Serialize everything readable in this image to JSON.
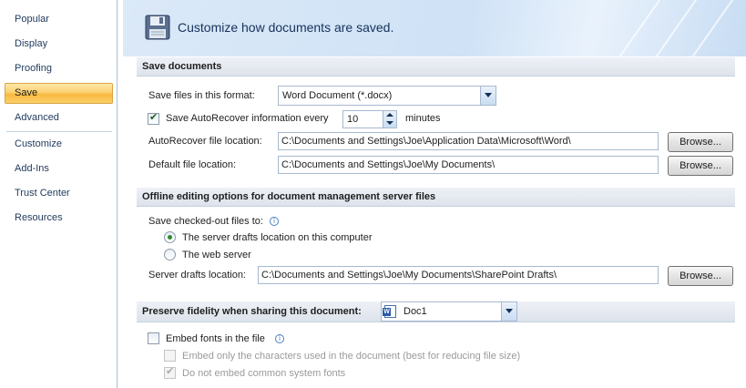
{
  "sidebar": {
    "items": [
      {
        "label": "Popular"
      },
      {
        "label": "Display"
      },
      {
        "label": "Proofing"
      },
      {
        "label": "Save"
      },
      {
        "label": "Advanced"
      },
      {
        "label": "Customize"
      },
      {
        "label": "Add-Ins"
      },
      {
        "label": "Trust Center"
      },
      {
        "label": "Resources"
      }
    ],
    "selected": "Save"
  },
  "banner": {
    "title": "Customize how documents are saved.",
    "icon": "floppy-disk-icon"
  },
  "save_documents": {
    "header": "Save documents",
    "format_label": "Save files in this format:",
    "format_value": "Word Document (*.docx)",
    "autorecover_checkbox_label": "Save AutoRecover information every",
    "autorecover_checked": true,
    "autorecover_minutes": "10",
    "minutes_label": "minutes",
    "autorecover_location_label": "AutoRecover file location:",
    "autorecover_location_value": "C:\\Documents and Settings\\Joe\\Application Data\\Microsoft\\Word\\",
    "default_location_label": "Default file location:",
    "default_location_value": "C:\\Documents and Settings\\Joe\\My Documents\\",
    "browse_label": "Browse..."
  },
  "offline_editing": {
    "header": "Offline editing options for document management server files",
    "checked_out_label": "Save checked-out files to:",
    "radio_server_drafts": "The server drafts location on this computer",
    "radio_web_server": "The web server",
    "selected_radio": "server_drafts",
    "drafts_location_label": "Server drafts location:",
    "drafts_location_value": "C:\\Documents and Settings\\Joe\\My Documents\\SharePoint Drafts\\",
    "browse_label": "Browse..."
  },
  "fidelity": {
    "header": "Preserve fidelity when sharing this document:",
    "document_value": "Doc1",
    "embed_fonts_label": "Embed fonts in the file",
    "embed_fonts_checked": false,
    "embed_used_chars_label": "Embed only the characters used in the document (best for reducing file size)",
    "embed_used_chars_checked": false,
    "no_common_fonts_label": "Do not embed common system fonts",
    "no_common_fonts_checked": true
  },
  "colors": {
    "selected_nav": "#f9b93e",
    "banner": "#cfe2f6",
    "header_text": "#15315a"
  }
}
